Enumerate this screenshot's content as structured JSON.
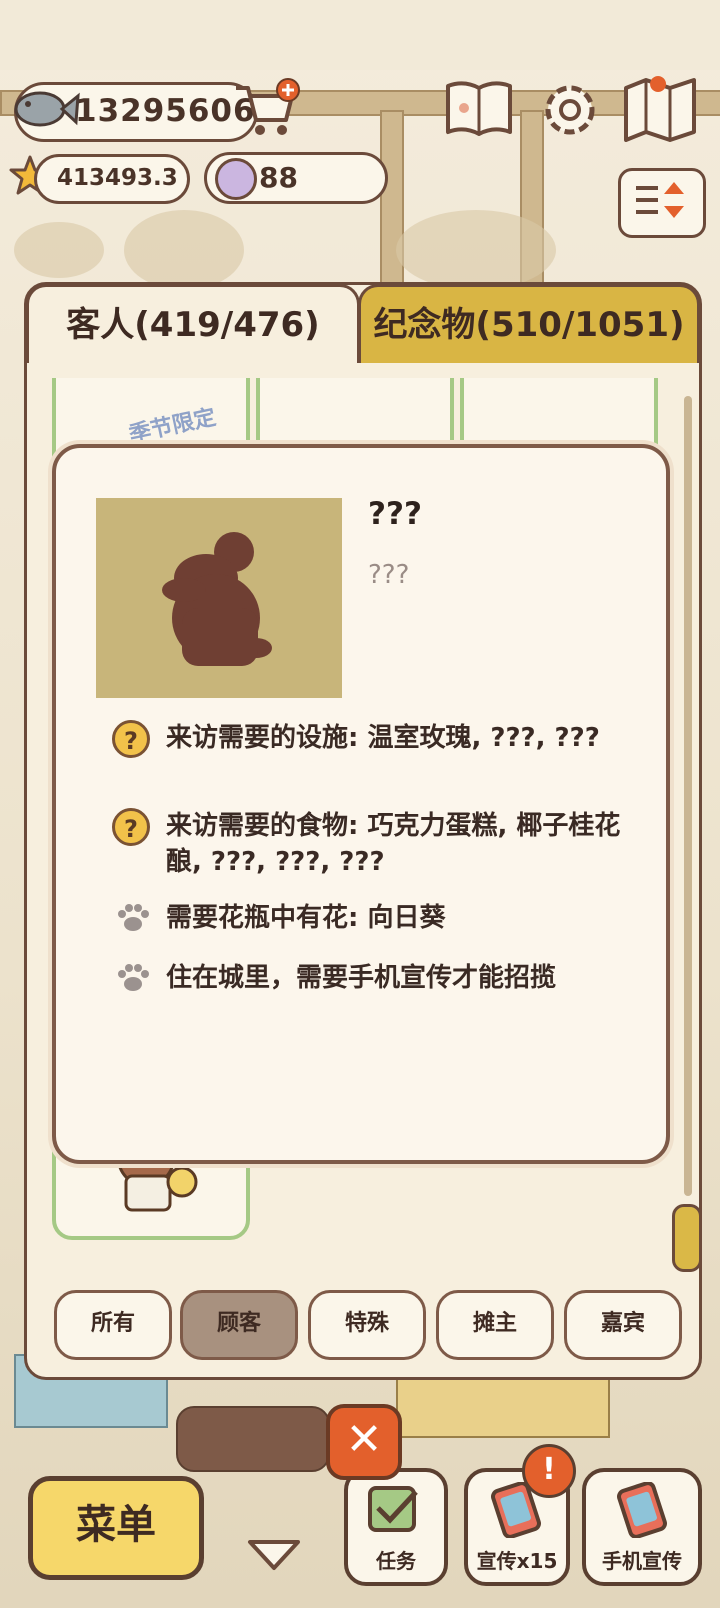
{
  "currency": {
    "fish": "13295606",
    "stars": "413493.3",
    "paw_points": "88"
  },
  "tabs": [
    {
      "label": "客人(419/476)",
      "active": true
    },
    {
      "label": "纪念物(510/1051)",
      "active": false
    }
  ],
  "card_stamp": "季节限定",
  "detail": {
    "name": "???",
    "description": "???",
    "requirements": [
      {
        "icon": "question-icon",
        "text": "来访需要的设施: 温室玫瑰, ???, ???"
      },
      {
        "icon": "question-icon",
        "text": "来访需要的食物: 巧克力蛋糕, 椰子桂花酿, ???, ???, ???"
      },
      {
        "icon": "paw-icon",
        "text": "需要花瓶中有花: 向日葵"
      },
      {
        "icon": "paw-icon",
        "text": "住在城里，需要手机宣传才能招揽"
      }
    ]
  },
  "filters": [
    {
      "label": "所有",
      "active": false
    },
    {
      "label": "顾客",
      "active": true
    },
    {
      "label": "特殊",
      "active": false
    },
    {
      "label": "摊主",
      "active": false
    },
    {
      "label": "嘉宾",
      "active": false
    }
  ],
  "bottom": {
    "menu": "菜单",
    "tasks": "任务",
    "promote": "宣传x15",
    "phone_promote": "手机宣传",
    "badge": "!"
  },
  "colors": {
    "accent": "#d9b544",
    "outline": "#6b4a3a",
    "card_border": "#a5c985",
    "close": "#e3602c"
  }
}
